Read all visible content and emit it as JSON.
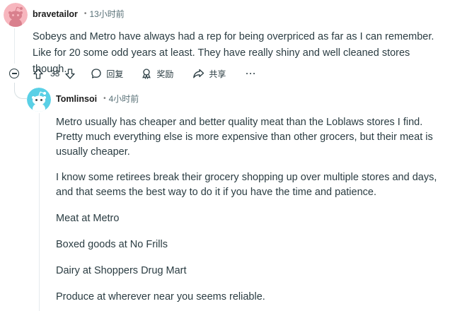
{
  "comment": {
    "username": "bravetailor",
    "time": "13小时前",
    "text": "Sobeys and Metro have always had a rep for being overpriced as far as I can remember. Like for 20 some odd years at least. They have really shiny and well cleaned stores though.",
    "vote_count": "33",
    "reply_label": "回复",
    "award_label": "奖励",
    "share_label": "共享",
    "more_label": "···"
  },
  "reply": {
    "username": "Tomlinsoi",
    "time": "4小时前",
    "paragraphs": [
      "Metro usually has cheaper and better quality meat than the Loblaws stores I find. Pretty much everything else is more expensive than other grocers, but their meat is usually cheaper.",
      "I know some retirees break their grocery shopping up over multiple stores and days, and that seems the best way to do it if you have the time and patience.",
      "Meat at Metro",
      "Boxed goods at No Frills",
      "Dairy at Shoppers Drug Mart",
      "Produce at wherever near you seems reliable."
    ]
  },
  "colors": {
    "avatar_pink": "#f7b6be",
    "avatar_cyan": "#5ad0e6",
    "text": "#2a3c42"
  }
}
